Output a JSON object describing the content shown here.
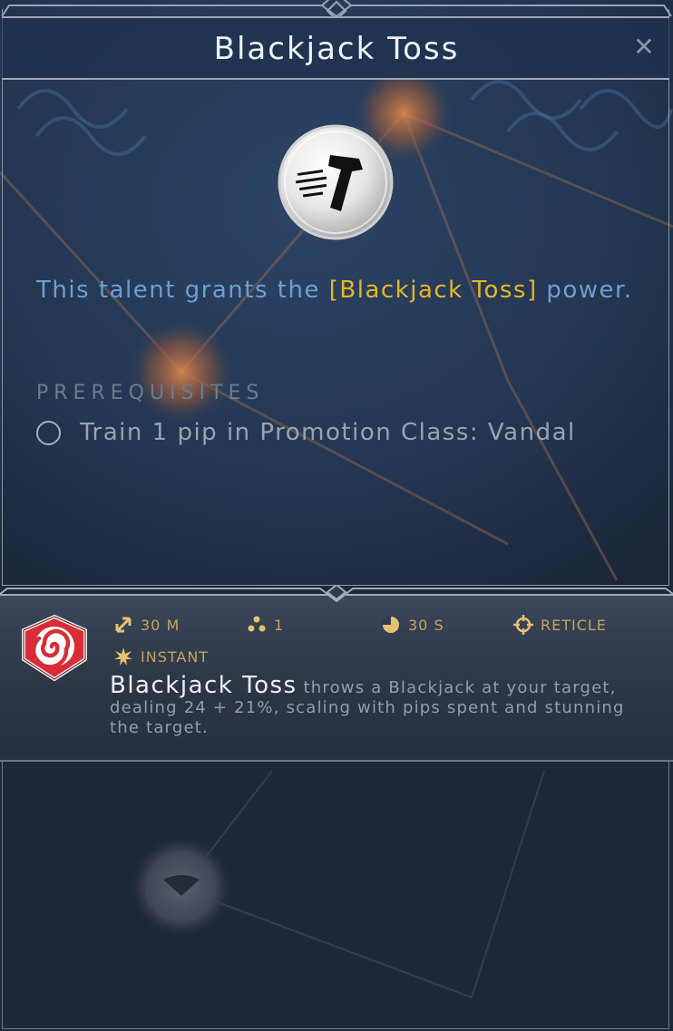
{
  "dialog": {
    "title": "Blackjack Toss",
    "close_icon": "close-icon",
    "talent_icon": "hammer-throw-icon",
    "description_prefix": "This talent grants the ",
    "description_power": "[Blackjack Toss]",
    "description_suffix": " power.",
    "prerequisites_heading": "PREREQUISITES",
    "prerequisites": [
      {
        "text": "Train 1 pip in Promotion Class: Vandal",
        "met": false
      }
    ]
  },
  "power": {
    "icon": "swirl-hexagon-icon",
    "stats": {
      "range": "30 M",
      "pips": "1",
      "cooldown": "30 S",
      "targeting": "RETICLE",
      "cast": "INSTANT"
    },
    "name": "Blackjack Toss",
    "description": " throws a Blackjack at your target, dealing 24 + 21%, scaling with pips spent and stunning the target."
  },
  "colors": {
    "accent_gold": "#e7b525",
    "text_blue": "#6f9ed0",
    "stat_gold": "#c7a35a",
    "frame": "#9aa6b6"
  }
}
